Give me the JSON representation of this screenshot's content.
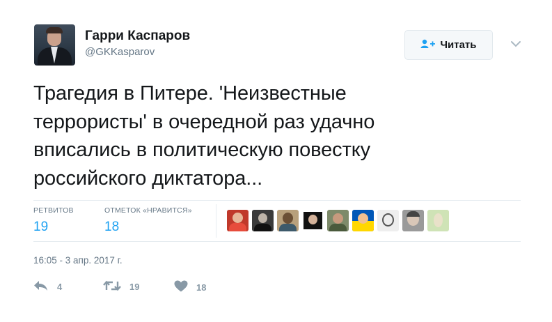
{
  "author": {
    "name": "Гарри Каспаров",
    "handle": "@GKKasparov"
  },
  "follow_button": {
    "label": "Читать"
  },
  "tweet": {
    "lines": [
      "Трагедия в Питере. 'Неизвестные",
      "террористы' в очередной раз удачно",
      "вписались в политическую повестку",
      "российского диктатора..."
    ]
  },
  "stats": {
    "retweets_label": "РЕТВИТОВ",
    "retweets_value": "19",
    "likes_label": "ОТМЕТОК «НРАВИТСЯ»",
    "likes_value": "18"
  },
  "likers": [
    {
      "icon": "liker-avatar-1",
      "color": "#c0392b"
    },
    {
      "icon": "liker-avatar-2",
      "color": "#2f2f2f"
    },
    {
      "icon": "liker-avatar-3",
      "color": "#9c7b55"
    },
    {
      "icon": "liker-avatar-4",
      "color": "#1b1b1b"
    },
    {
      "icon": "liker-avatar-5",
      "color": "#7d8a6a"
    },
    {
      "icon": "liker-avatar-6",
      "color": "#f2c200"
    },
    {
      "icon": "liker-avatar-7",
      "color": "#d8d8d8"
    },
    {
      "icon": "liker-avatar-8",
      "color": "#8a8a8a"
    },
    {
      "icon": "liker-avatar-9",
      "color": "#a9c48d"
    }
  ],
  "timestamp": "16:05 - 3 апр. 2017 г.",
  "actions": {
    "reply_icon": "reply-icon",
    "reply_count": "4",
    "retweet_icon": "retweet-icon",
    "retweet_count": "19",
    "like_icon": "heart-icon",
    "like_count": "18"
  },
  "colors": {
    "accent": "#1da1f2",
    "text": "#14171a",
    "muted": "#657786",
    "action_gray": "#8899a6"
  }
}
